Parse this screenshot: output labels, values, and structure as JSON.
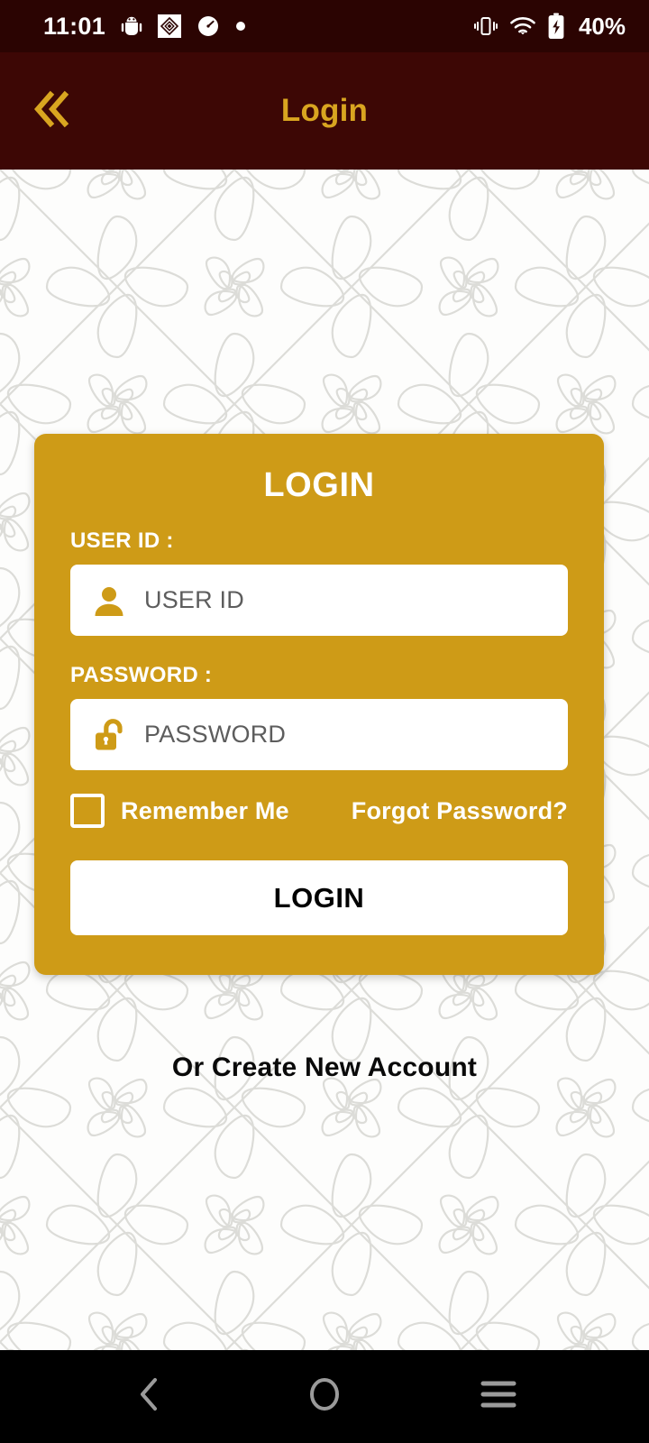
{
  "status_bar": {
    "time": "11:01",
    "battery_percent": "40%",
    "left_icons": [
      "android-bug-icon",
      "diamond-badge-icon",
      "speedometer-icon",
      "dot-indicator-icon"
    ],
    "right_icons": [
      "vibrate-icon",
      "wifi-icon",
      "battery-charging-icon"
    ],
    "background_color": "#2b0402",
    "foreground_color": "#ffffff"
  },
  "header": {
    "title": "Login",
    "back_icon": "double-chevron-left-icon",
    "background_color": "#3d0705",
    "accent_color": "#d9a520"
  },
  "card": {
    "title": "LOGIN",
    "background_color": "#ce9b17",
    "userid": {
      "label": "USER ID :",
      "placeholder": "USER ID",
      "value": "",
      "icon": "person-icon"
    },
    "password": {
      "label": "PASSWORD :",
      "placeholder": "PASSWORD",
      "value": "",
      "icon": "unlocked-padlock-icon"
    },
    "remember_me": {
      "label": "Remember Me",
      "checked": false
    },
    "forgot_password_label": "Forgot Password?",
    "login_button_label": "LOGIN"
  },
  "create_account_label": "Or Create New Account",
  "nav_bar": {
    "background_color": "#000000",
    "icon_color": "#9a9a9a",
    "buttons": [
      {
        "name": "back",
        "icon": "chevron-left-icon"
      },
      {
        "name": "home",
        "icon": "circle-icon"
      },
      {
        "name": "recents",
        "icon": "hamburger-icon"
      }
    ]
  }
}
